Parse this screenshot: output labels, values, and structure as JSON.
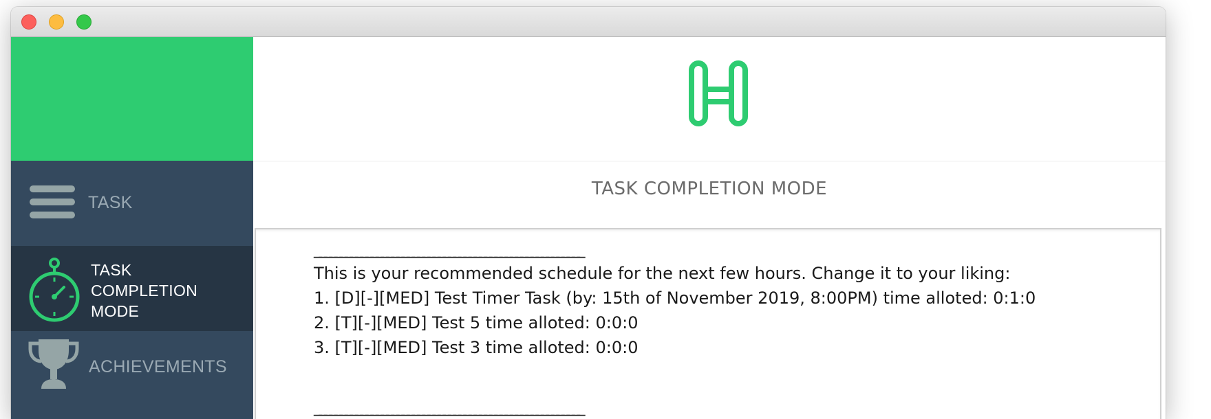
{
  "window": {
    "controls": [
      "close",
      "minimize",
      "maximize"
    ]
  },
  "sidebar": {
    "header_color": "#2ecc71",
    "background_color": "#34495e",
    "items": [
      {
        "label": "TASK",
        "icon": "hamburger-menu-icon",
        "active": false
      },
      {
        "label": "TASK COMPLETION MODE",
        "label_lines": [
          "TASK",
          "COMPLETION",
          "MODE"
        ],
        "icon": "stopwatch-icon",
        "active": true
      },
      {
        "label": "ACHIEVEMENTS",
        "icon": "trophy-icon",
        "active": false
      }
    ]
  },
  "main": {
    "logo": "h-logo-icon",
    "accent_color": "#2ecc71",
    "title": "TASK COMPLETION MODE",
    "output": {
      "separator": "____________________________________________________",
      "lines": [
        "This is your recommended schedule for the next few hours. Change it to your liking:",
        "1. [D][-][MED] Test Timer Task (by: 15th of November 2019, 8:00PM) time alloted: 0:1:0",
        "2. [T][-][MED] Test 5 time alloted: 0:0:0",
        "3. [T][-][MED] Test 3 time alloted: 0:0:0"
      ]
    }
  }
}
